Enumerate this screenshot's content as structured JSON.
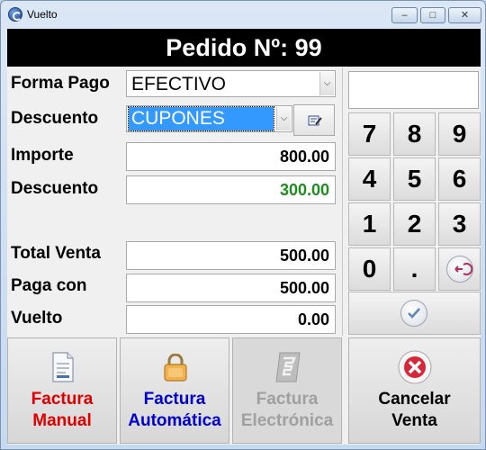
{
  "window": {
    "title": "Vuelto",
    "minimize": "–",
    "maximize": "□",
    "close": "✕"
  },
  "header": {
    "title": "Pedido Nº: 99"
  },
  "form": {
    "forma_pago_label": "Forma Pago",
    "forma_pago_value": "EFECTIVO",
    "descuento_label": "Descuento",
    "descuento_value": "CUPONES",
    "importe_label": "Importe",
    "importe_value": "800.00",
    "descuento_monto_label": "Descuento",
    "descuento_monto_value": "300.00",
    "total_label": "Total Venta",
    "total_value": "500.00",
    "paga_label": "Paga con",
    "paga_value": "500.00",
    "vuelto_label": "Vuelto",
    "vuelto_value": "0.00"
  },
  "keypad": {
    "display": "",
    "keys": [
      "7",
      "8",
      "9",
      "4",
      "5",
      "6",
      "1",
      "2",
      "3",
      "0",
      "."
    ],
    "icons": {
      "backspace": "backspace-icon",
      "confirm": "checkmark-icon",
      "edit": "edit-icon"
    }
  },
  "buttons": {
    "factura_manual": "Factura\nManual",
    "factura_automatica": "Factura\nAutomática",
    "factura_electronica": "Factura\nElectrónica",
    "cancelar_venta": "Cancelar\nVenta"
  },
  "colors": {
    "manual": "#e00000",
    "automatica": "#0000d0",
    "electronica": "#a0a0a0",
    "cancelar": "#000000",
    "discount_value": "#1e8c1e"
  }
}
